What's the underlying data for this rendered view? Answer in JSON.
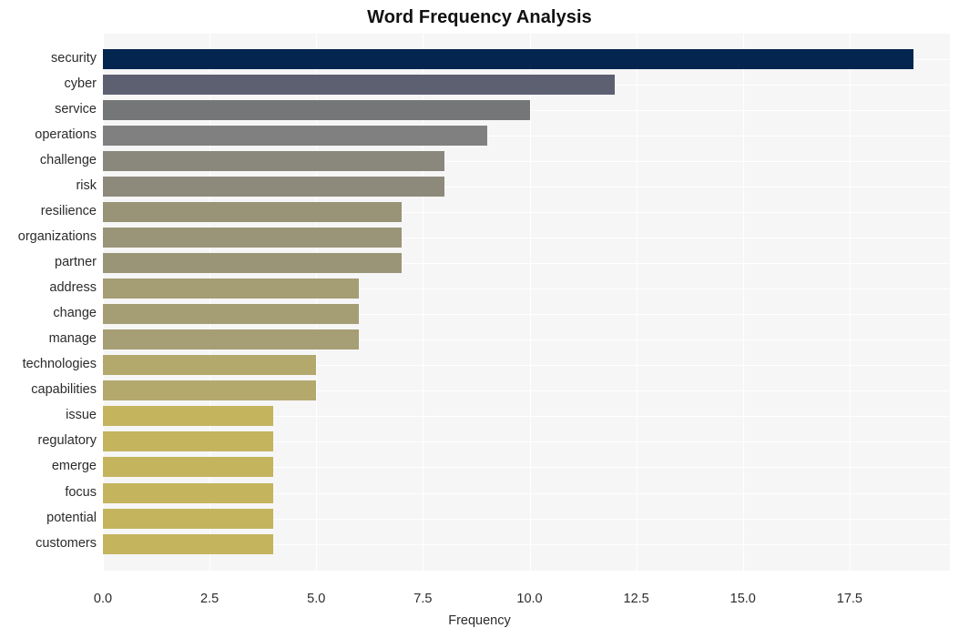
{
  "chart_data": {
    "type": "bar",
    "orientation": "horizontal",
    "title": "Word Frequency Analysis",
    "xlabel": "Frequency",
    "ylabel": "",
    "xlim": [
      0,
      19.85
    ],
    "xticks": [
      0.0,
      2.5,
      5.0,
      7.5,
      10.0,
      12.5,
      15.0,
      17.5
    ],
    "xtick_labels": [
      "0.0",
      "2.5",
      "5.0",
      "7.5",
      "10.0",
      "12.5",
      "15.0",
      "17.5"
    ],
    "grid": true,
    "legend": "none",
    "plot_background": "#f6f6f6",
    "grid_color": "#ffffff",
    "categories": [
      "security",
      "cyber",
      "service",
      "operations",
      "challenge",
      "risk",
      "resilience",
      "organizations",
      "partner",
      "address",
      "change",
      "manage",
      "technologies",
      "capabilities",
      "issue",
      "regulatory",
      "emerge",
      "focus",
      "potential",
      "customers"
    ],
    "values": [
      19,
      12,
      10,
      9,
      8,
      8,
      7,
      7,
      7,
      6,
      6,
      6,
      5,
      5,
      4,
      4,
      4,
      4,
      4,
      4
    ],
    "bar_colors": [
      "#03254f",
      "#5c6070",
      "#757677",
      "#808080",
      "#8a877c",
      "#8d8a7c",
      "#999377",
      "#9a9478",
      "#9b9578",
      "#a59d74",
      "#a59d74",
      "#a69e74",
      "#b3a96c",
      "#b3a96c",
      "#c4b45e",
      "#c4b45e",
      "#c4b45e",
      "#c4b45e",
      "#c4b45e",
      "#c4b45e"
    ]
  }
}
